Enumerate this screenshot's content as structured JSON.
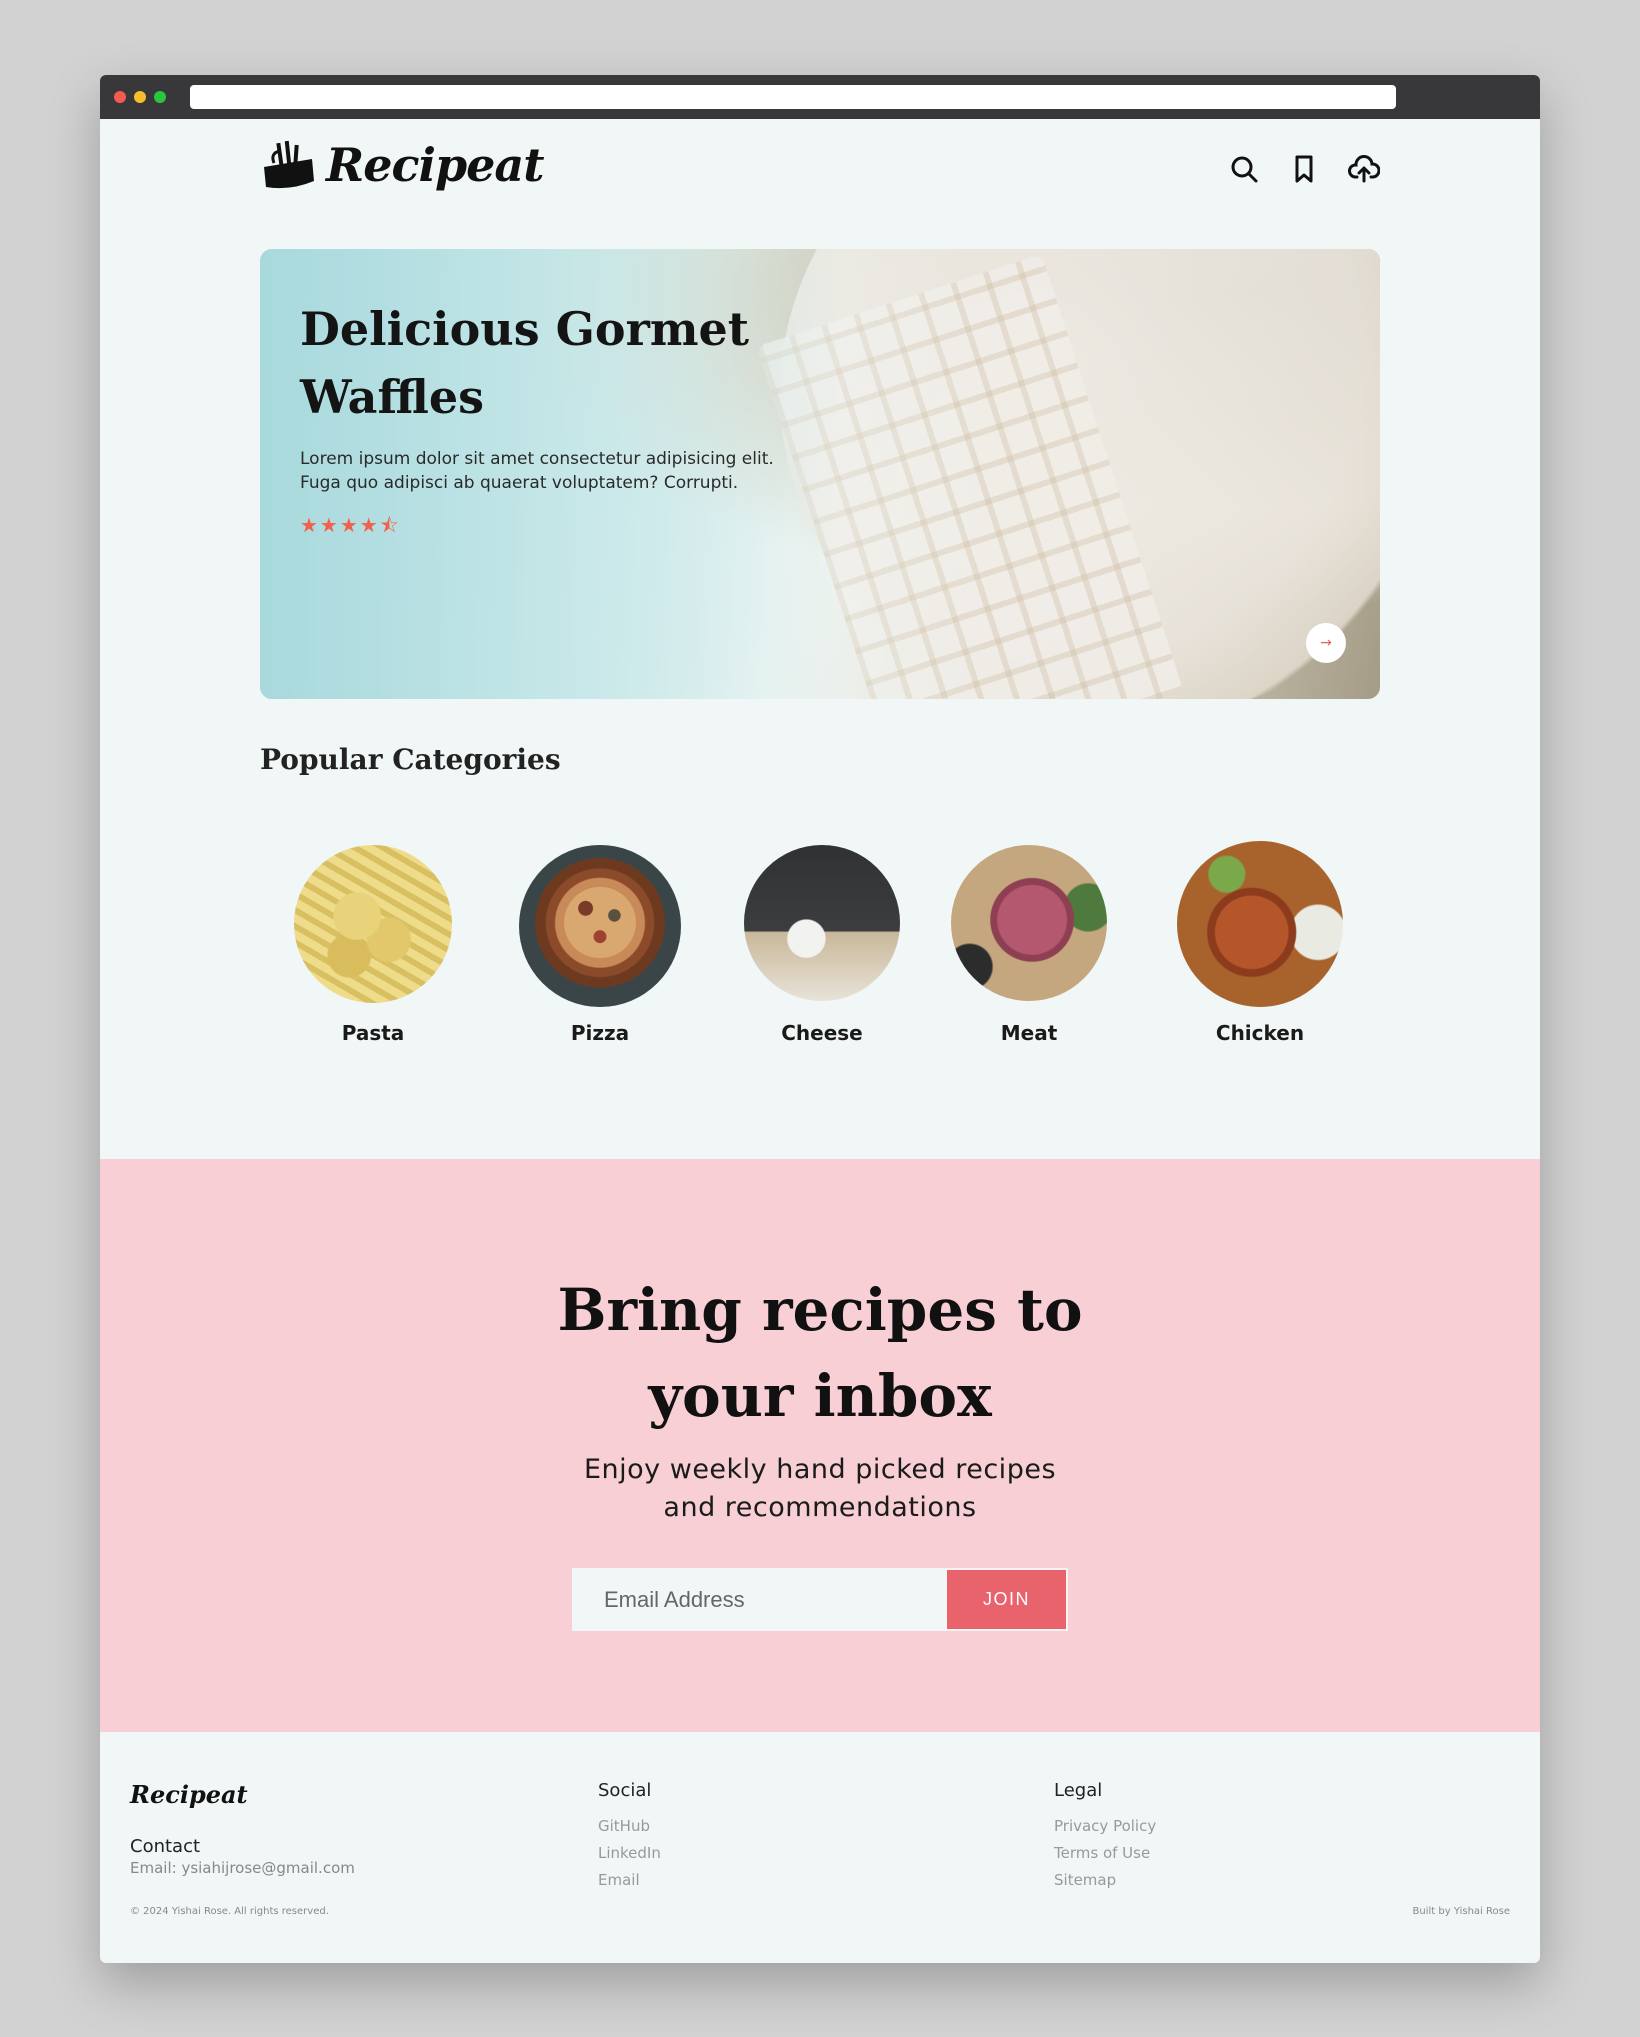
{
  "brand": {
    "name": "Recipeat"
  },
  "header": {
    "icons": [
      "search-icon",
      "bookmark-icon",
      "cloud-upload-icon"
    ]
  },
  "hero": {
    "title": "Delicious Gormet Waffles",
    "description": "Lorem ipsum dolor sit amet consectetur adipisicing elit. Fuga quo adipisci ab quaerat voluptatem? Corrupti.",
    "stars": "★★★★⯪",
    "rating": 4.5,
    "next_label": "→"
  },
  "categories": {
    "heading": "Popular Categories",
    "items": [
      {
        "label": "Pasta"
      },
      {
        "label": "Pizza"
      },
      {
        "label": "Cheese"
      },
      {
        "label": "Meat"
      },
      {
        "label": "Chicken"
      }
    ]
  },
  "newsletter": {
    "title_line1": "Bring recipes to",
    "title_line2": "your inbox",
    "subtitle_line1": "Enjoy weekly hand picked recipes",
    "subtitle_line2": "and recommendations",
    "email_placeholder": "Email Address",
    "button_label": "JOIN"
  },
  "footer": {
    "brand": "Recipeat",
    "contact_label": "Contact",
    "email": "Email: ysiahijrose@gmail.com",
    "copyright": "© 2024 Yishai Rose. All rights reserved.",
    "social": {
      "title": "Social",
      "links": [
        "GitHub",
        "LinkedIn",
        "Email"
      ]
    },
    "legal": {
      "title": "Legal",
      "links": [
        "Privacy Policy",
        "Terms of Use",
        "Sitemap"
      ]
    },
    "built_by": "Built by Yishai Rose"
  },
  "colors": {
    "page_bg": "#f0f7f6",
    "newsletter_bg": "#f7cfd4",
    "join_button": "#e9636d",
    "star": "#f0604a"
  }
}
